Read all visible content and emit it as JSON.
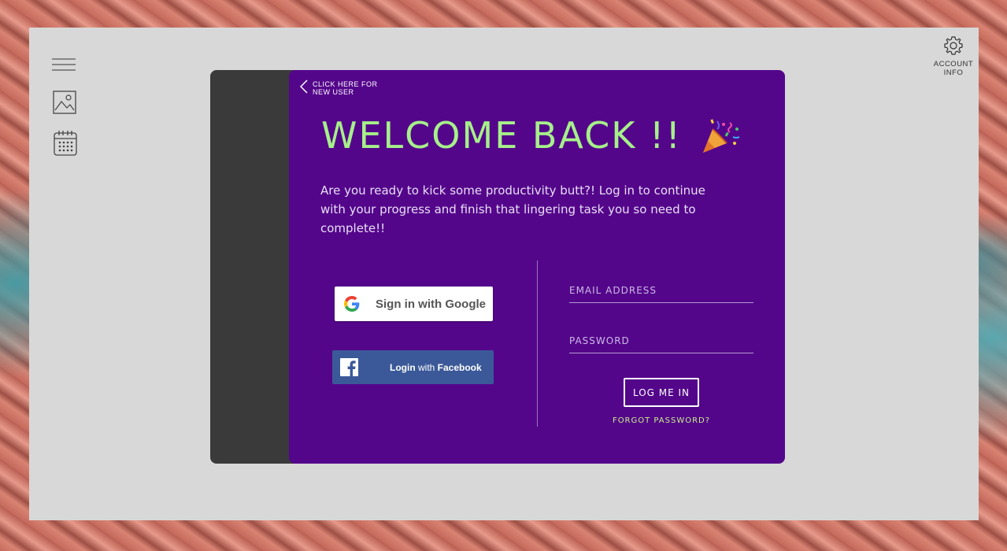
{
  "sidebar": {
    "icons": [
      "hamburger-menu-icon",
      "image-icon",
      "calendar-icon"
    ]
  },
  "account": {
    "icon": "gear-icon",
    "line1": "ACCOUNT",
    "line2": "INFO"
  },
  "card": {
    "back_label": "CLICK HERE FOR NEW USER",
    "title": "WELCOME BACK !!",
    "title_emoji_icon": "party-popper-icon",
    "subtitle": "Are you ready to kick some productivity butt?! Log in to continue with your progress and finish that lingering task you so need to complete!!",
    "google_label": "Sign in with Google",
    "facebook_label_prefix": "Login",
    "facebook_label_with": " with ",
    "facebook_label_suffix": "Facebook",
    "email_placeholder": "EMAIL ADDRESS",
    "password_placeholder": "PASSWORD",
    "login_label": "LOG ME IN",
    "forgot_label": "FORGOT PASSWORD?"
  },
  "colors": {
    "card_bg": "#54068b",
    "title": "#a6f08a",
    "forgot": "#c5f08c",
    "facebook": "#3b5998",
    "panel": "#d8d8d8"
  }
}
